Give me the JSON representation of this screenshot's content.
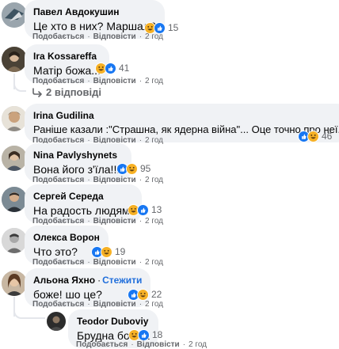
{
  "actions": {
    "like": "Подобається",
    "reply": "Відповісти",
    "dot": "·"
  },
  "colors": {
    "bubble": "#f0f2f5",
    "meta": "#65676b",
    "link": "#216fdb",
    "like": "#1877f2",
    "haha": "#f7b125"
  },
  "reply_toggle": "2 відповіді",
  "comments": [
    {
      "author": "Павел Авдокушин",
      "text": "Це хто в них? Маршал?",
      "reactions": [
        "haha",
        "like"
      ],
      "count": "15",
      "time": "2 год"
    },
    {
      "author": "Ira Kossareffa",
      "text": "Матір божа...",
      "reactions": [
        "haha",
        "like"
      ],
      "count": "41",
      "time": "2 год"
    },
    {
      "author": "Irina Gudilina",
      "text": "Раніше казали :\"Страшна, як ядерна війна\"... Оце точно про неї.",
      "reactions": [
        "like",
        "haha"
      ],
      "count": "46",
      "time": "2 год"
    },
    {
      "author": "Nina Pavlyshynets",
      "text": "Вона його з'їла!!!!",
      "reactions": [
        "like",
        "haha"
      ],
      "count": "95",
      "time": "2 год"
    },
    {
      "author": "Сергей Середа",
      "text": "На радость людям!",
      "reactions": [
        "haha",
        "like"
      ],
      "count": "13",
      "time": "2 год"
    },
    {
      "author": "Олекса Ворон",
      "text": "Что это?",
      "reactions": [
        "like",
        "haha"
      ],
      "count": "19",
      "time": "2 год"
    },
    {
      "author": "Альона Яхно",
      "follow": "Стежити",
      "text": "боже! шо це?",
      "reactions": [
        "like",
        "haha"
      ],
      "count": "22",
      "time": "2 год"
    },
    {
      "author": "Teodor Duboviy",
      "text": "Брудна бомба",
      "reactions": [
        "haha",
        "like"
      ],
      "count": "18",
      "time": "2 год"
    }
  ]
}
